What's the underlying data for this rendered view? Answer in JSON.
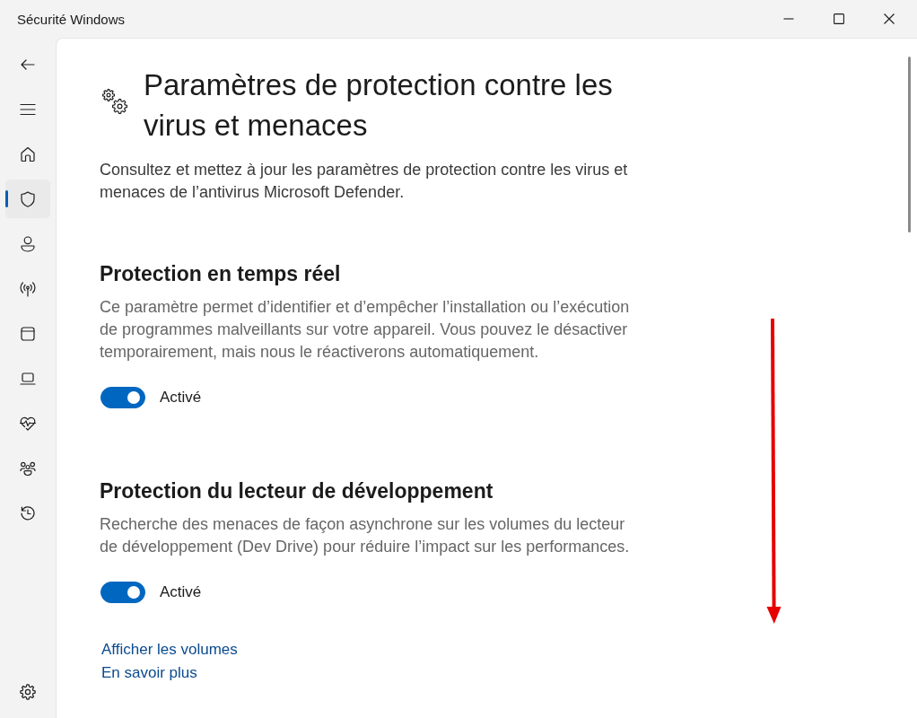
{
  "window": {
    "title": "Sécurité Windows"
  },
  "nav_buttons": [
    {
      "kind": "back"
    },
    {
      "kind": "menu"
    }
  ],
  "nav_items": [
    {
      "kind": "home",
      "selected": false
    },
    {
      "kind": "shield",
      "selected": true
    },
    {
      "kind": "account",
      "selected": false
    },
    {
      "kind": "network",
      "selected": false
    },
    {
      "kind": "app",
      "selected": false
    },
    {
      "kind": "device",
      "selected": false
    },
    {
      "kind": "health",
      "selected": false
    },
    {
      "kind": "family",
      "selected": false
    },
    {
      "kind": "history",
      "selected": false
    }
  ],
  "nav_footer": [
    {
      "kind": "settings",
      "selected": false
    }
  ],
  "page": {
    "title": "Paramètres de protection contre les virus et menaces",
    "description": "Consultez et mettez à jour les paramètres de protection contre les virus et menaces de l’antivirus Microsoft Defender."
  },
  "sections": [
    {
      "heading": "Protection en temps réel",
      "text": "Ce paramètre permet d’identifier et d’empêcher l’installation ou l’exécution de programmes malveillants sur votre appareil. Vous pouvez le désactiver temporairement, mais nous le réactiverons automatiquement.",
      "toggle": {
        "on": true,
        "label": "Activé"
      }
    },
    {
      "heading": "Protection du lecteur de développement",
      "text": "Recherche des menaces de façon asynchrone sur les volumes du lecteur de développement (Dev Drive) pour réduire l’impact sur les performances.",
      "toggle": {
        "on": true,
        "label": "Activé"
      }
    }
  ],
  "links": [
    "Afficher les volumes",
    "En savoir plus"
  ]
}
